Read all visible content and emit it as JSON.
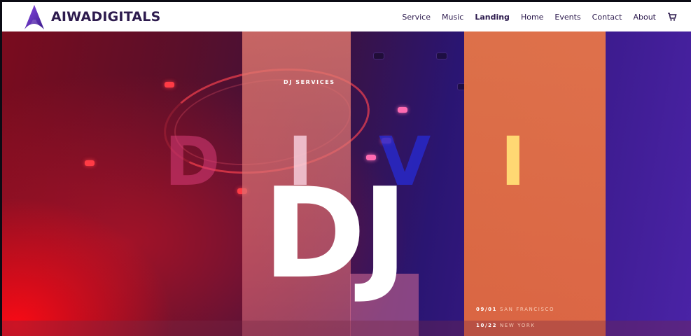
{
  "brand": {
    "name": "AIWADIGITALS",
    "color": "#2d1b4e",
    "logo_color": "#6b2fc4"
  },
  "nav": {
    "items": [
      {
        "label": "Service"
      },
      {
        "label": "Music"
      },
      {
        "label": "Landing"
      },
      {
        "label": "Home"
      },
      {
        "label": "Events"
      },
      {
        "label": "Contact"
      },
      {
        "label": "About"
      }
    ],
    "cart_icon": "shopping-cart-icon"
  },
  "hero": {
    "kicker": "DJ SERVICES",
    "letters": [
      "D",
      "I",
      "V",
      "I"
    ],
    "headline": "DJ",
    "events": [
      {
        "date": "09/01",
        "city": "SAN FRANCISCO"
      },
      {
        "date": "10/22",
        "city": "NEW YORK"
      }
    ],
    "colors": {
      "red": "#ff0a14",
      "purple": "#4a23a6",
      "orange": "#ec7846",
      "yellow": "#ffd873"
    }
  }
}
